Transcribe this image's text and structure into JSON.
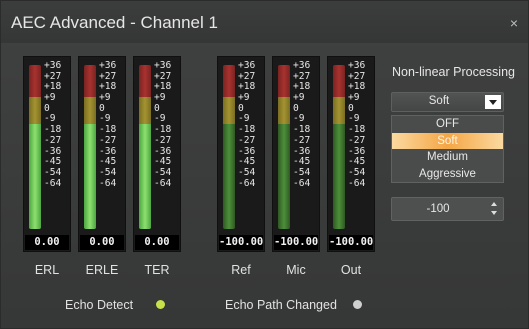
{
  "window": {
    "title": "AEC Advanced - Channel 1",
    "close_glyph": "×"
  },
  "scale_ticks": [
    "+36",
    "+27",
    "+18",
    "+9",
    "0",
    "-9",
    "-18",
    "-27",
    "-36",
    "-45",
    "-54",
    "-64"
  ],
  "meters": [
    {
      "label": "ERL",
      "readout": "0.00",
      "fill_level_db": 0
    },
    {
      "label": "ERLE",
      "readout": "0.00",
      "fill_level_db": 0
    },
    {
      "label": "TER",
      "readout": "0.00",
      "fill_level_db": 0
    },
    {
      "label": "Ref",
      "readout": "-100.00",
      "fill_level_db": -100
    },
    {
      "label": "Mic",
      "readout": "-100.00",
      "fill_level_db": -100
    },
    {
      "label": "Out",
      "readout": "-100.00",
      "fill_level_db": -100
    }
  ],
  "nonlinear": {
    "label": "Non-linear Processing",
    "selected": "Soft",
    "options": [
      "OFF",
      "Soft",
      "Medium",
      "Aggressive"
    ],
    "highlighted": "Soft"
  },
  "spinbox": {
    "value": "-100"
  },
  "status": {
    "echo_detect_label": "Echo Detect",
    "echo_detect_color": "#c8e04a",
    "echo_path_label": "Echo Path Changed",
    "echo_path_color": "#cfcfcf"
  },
  "colors": {
    "background": "#3a3b3b",
    "meter_red": "#a8322e",
    "meter_yellow": "#a49330",
    "meter_green": "#4d8f3a",
    "meter_bright_green": "#8ee06f",
    "highlight_orange": "#f5a645"
  }
}
